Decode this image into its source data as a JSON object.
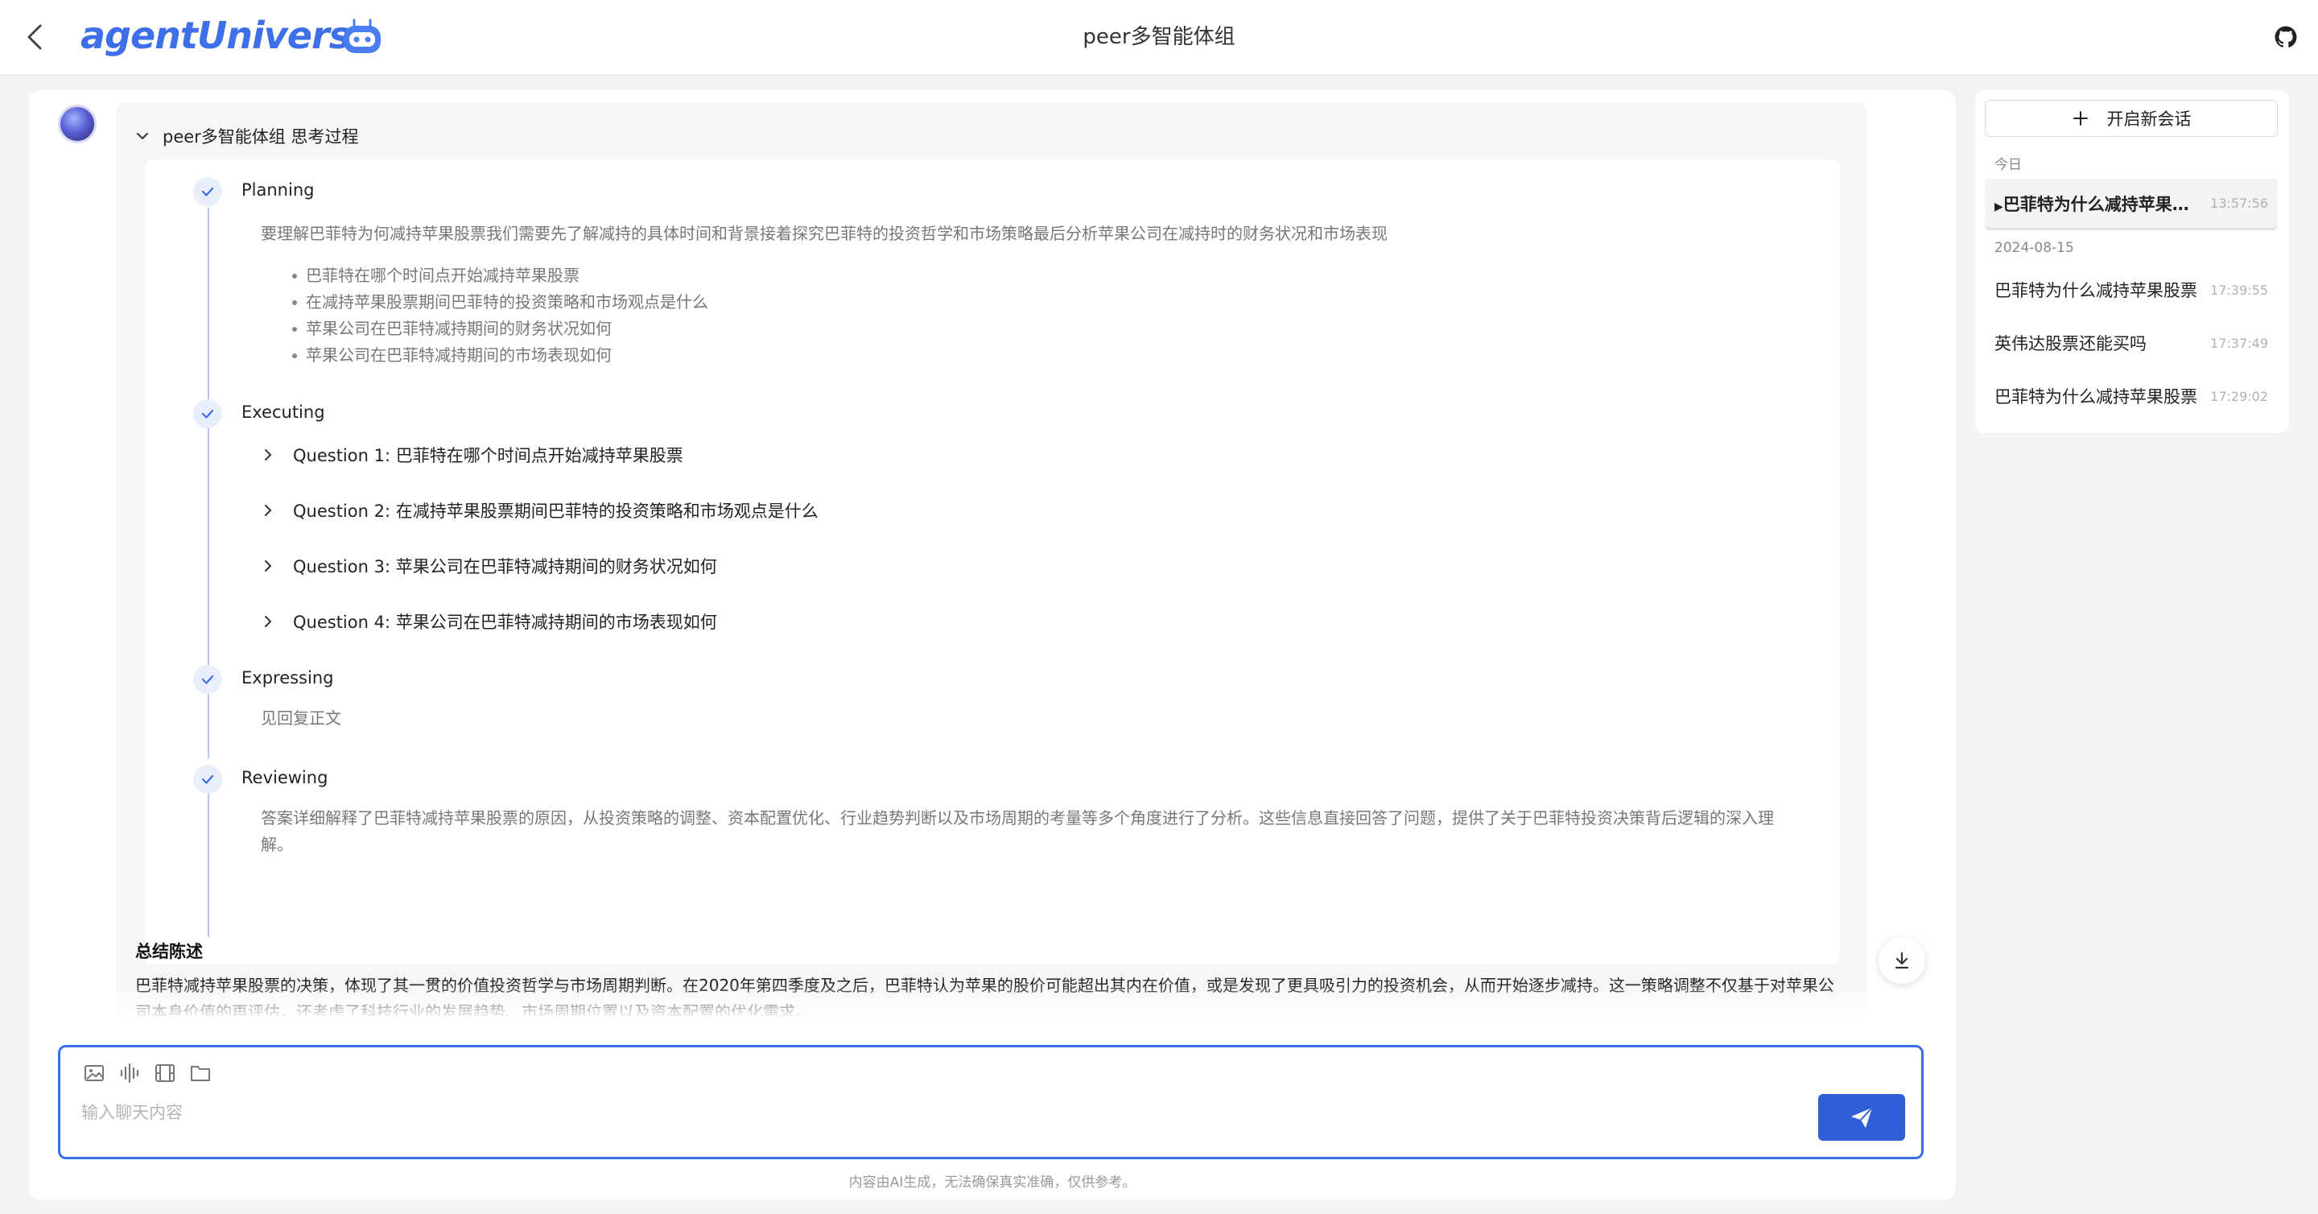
{
  "header": {
    "brand": "agentUniverse",
    "title": "peer多智能体组"
  },
  "thinking": {
    "title": "peer多智能体组 思考过程",
    "steps": {
      "planning": {
        "title": "Planning",
        "text": "要理解巴菲特为何减持苹果股票我们需要先了解减持的具体时间和背景接着探究巴菲特的投资哲学和市场策略最后分析苹果公司在减持时的财务状况和市场表现",
        "bullets": [
          "巴菲特在哪个时间点开始减持苹果股票",
          "在减持苹果股票期间巴菲特的投资策略和市场观点是什么",
          "苹果公司在巴菲特减持期间的财务状况如何",
          "苹果公司在巴菲特减持期间的市场表现如何"
        ]
      },
      "executing": {
        "title": "Executing",
        "questions": [
          "Question 1: 巴菲特在哪个时间点开始减持苹果股票",
          "Question 2: 在减持苹果股票期间巴菲特的投资策略和市场观点是什么",
          "Question 3: 苹果公司在巴菲特减持期间的财务状况如何",
          "Question 4: 苹果公司在巴菲特减持期间的市场表现如何"
        ]
      },
      "expressing": {
        "title": "Expressing",
        "text": "见回复正文"
      },
      "reviewing": {
        "title": "Reviewing",
        "text": "答案详细解释了巴菲特减持苹果股票的原因，从投资策略的调整、资本配置优化、行业趋势判断以及市场周期的考量等多个角度进行了分析。这些信息直接回答了问题，提供了关于巴菲特投资决策背后逻辑的深入理解。"
      }
    }
  },
  "summary": {
    "title": "总结陈述",
    "text": "巴菲特减持苹果股票的决策，体现了其一贯的价值投资哲学与市场周期判断。在2020年第四季度及之后，巴菲特认为苹果的股价可能超出其内在价值，或是发现了更具吸引力的投资机会，从而开始逐步减持。这一策略调整不仅基于对苹果公司本身价值的再评估，还考虑了科技行业的发展趋势、市场周期位置以及资本配置的优化需求。"
  },
  "input": {
    "placeholder": "输入聊天内容",
    "disclaimer": "内容由AI生成，无法确保真实准确，仅供参考。",
    "tools": [
      "image-icon",
      "audio-icon",
      "video-icon",
      "folder-icon"
    ]
  },
  "sidebar": {
    "new_chat_label": "开启新会话",
    "groups": [
      {
        "label": "今日",
        "sessions": [
          {
            "title": "巴菲特为什么减持苹果股票",
            "time": "13:57:56",
            "active": true
          }
        ]
      },
      {
        "label": "2024-08-15",
        "sessions": [
          {
            "title": "巴菲特为什么减持苹果股票",
            "time": "17:39:55"
          },
          {
            "title": "英伟达股票还能买吗",
            "time": "17:37:49"
          },
          {
            "title": "巴菲特为什么减持苹果股票",
            "time": "17:29:02"
          }
        ]
      }
    ]
  },
  "colors": {
    "accent": "#2e5fd6",
    "brand": "#3e6ee8",
    "check_bg": "#e8eefc",
    "timeline": "#b8c6ec"
  }
}
